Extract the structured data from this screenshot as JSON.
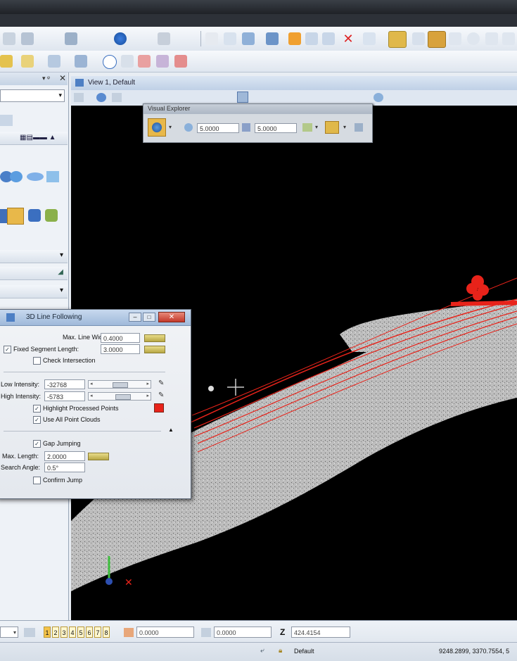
{
  "view": {
    "title": "View 1, Default"
  },
  "explorer": {
    "title": "Visual Explorer",
    "field1": "5.0000",
    "field2": "5.0000"
  },
  "dialog": {
    "title": "3D Line Following",
    "max_line_width_label": "Max. Line Width:",
    "max_line_width_value": "0.4000",
    "fixed_segment_label": "Fixed Segment Length:",
    "fixed_segment_value": "3.0000",
    "fixed_segment_checked": true,
    "check_intersection_label": "Check Intersection",
    "check_intersection_checked": false,
    "low_intensity_label": "Low Intensity:",
    "low_intensity_value": "-32768",
    "high_intensity_label": "High Intensity:",
    "high_intensity_value": "-5783",
    "highlight_label": "Highlight Processed Points",
    "highlight_checked": true,
    "highlight_color": "#e8231a",
    "use_all_label": "Use All Point Clouds",
    "use_all_checked": true,
    "gap_jumping_label": "Gap Jumping",
    "gap_jumping_checked": true,
    "max_length_label": "Max. Length:",
    "max_length_value": "2.0000",
    "search_angle_label": "Search Angle:",
    "search_angle_value": "0.5°",
    "confirm_jump_label": "Confirm Jump",
    "confirm_jump_checked": false,
    "check_mark": "✓"
  },
  "statusbar": {
    "view_numbers": [
      "1",
      "2",
      "3",
      "4",
      "5",
      "6",
      "7",
      "8"
    ],
    "x_value": "0.0000",
    "y_value": "0.0000",
    "z_label": "Z",
    "z_value": "424.4154",
    "level": "Default",
    "coords": "9248.2899, 3370.7554, 5"
  }
}
